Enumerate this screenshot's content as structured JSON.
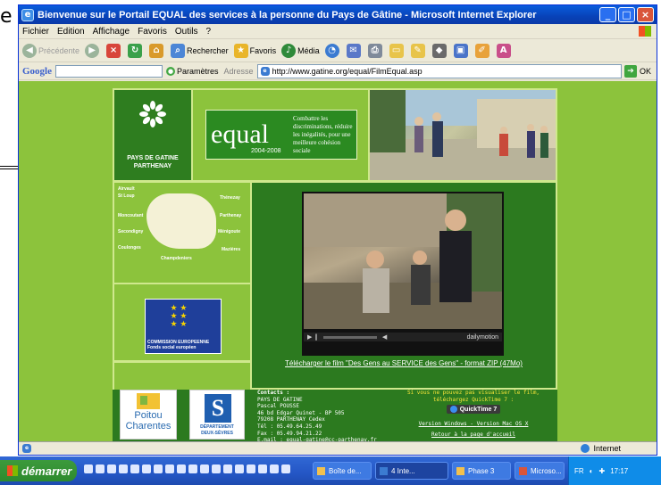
{
  "window": {
    "title": "Bienvenue sur le Portail EQUAL des services à la personne du Pays de Gâtine - Microsoft Internet Explorer",
    "min": "_",
    "max": "□",
    "close": "×"
  },
  "menu": [
    "Fichier",
    "Edition",
    "Affichage",
    "Favoris",
    "Outils",
    "?"
  ],
  "toolbar": {
    "back": "Précédente",
    "search": "Rechercher",
    "favorites": "Favoris",
    "media": "Média"
  },
  "address": {
    "google": "Google",
    "settings": "Paramètres",
    "label": "Adresse",
    "url": "http://www.gatine.org/equal/FilmEqual.asp",
    "go": "OK"
  },
  "site": {
    "logo_lines": [
      "PAYS DE GATINE",
      "PARTHENAY"
    ],
    "equal_word": "equal",
    "equal_years": "2004-2008",
    "equal_tagline": "Combattre les discriminations, réduire les inégalités, pour une meilleure cohésion sociale",
    "towns": [
      "Airvault",
      "St Loup",
      "Thénezay",
      "Moncoutant",
      "Parthenay",
      "Secondigny",
      "Ménigoute",
      "Coulonges",
      "Mazières",
      "Champdeniers"
    ],
    "eu_text": [
      "COMMISSION EUROPEENNE",
      "Fonds social européen"
    ],
    "video_brand": "dailymotion",
    "download_link": "Télécharger le film \"Des Gens au SERVICE des Gens\" - format ZIP (47Mo)",
    "poitou": [
      "Poitou",
      "Charentes"
    ],
    "deux_sevres": [
      "DÉPARTEMENT",
      "DEUX-SÈVRES"
    ],
    "contact": {
      "title": "Contacts :",
      "lines": [
        "PAYS DE GATINE",
        "Pascal POUSSE",
        "46 bd Edgar Quinet - BP 505",
        "79208 PARTHENAY Cedex",
        "Tél : 05.49.64.25.49",
        "Fax : 05.49.94.21.22"
      ],
      "email_label": "E.mail :",
      "email": "equal-gatine@cc-parthenay.fr"
    },
    "quicktime": {
      "msg1": "Si vous ne pouvez pas visualiser le film,",
      "msg2": "téléchargez QuickTime 7 :",
      "button": "QuickTime 7",
      "win": "Version Windows",
      "sep": " - ",
      "mac": "Version Mac OS X",
      "back": "Retour à la page d'accueil"
    }
  },
  "status": {
    "zone": "Internet"
  },
  "taskbar": {
    "start": "démarrer",
    "tasks": [
      "Boîte de...",
      "4 Inte...",
      "Phase 3",
      "Microso..."
    ],
    "lang": "FR",
    "clock": "17:17"
  }
}
